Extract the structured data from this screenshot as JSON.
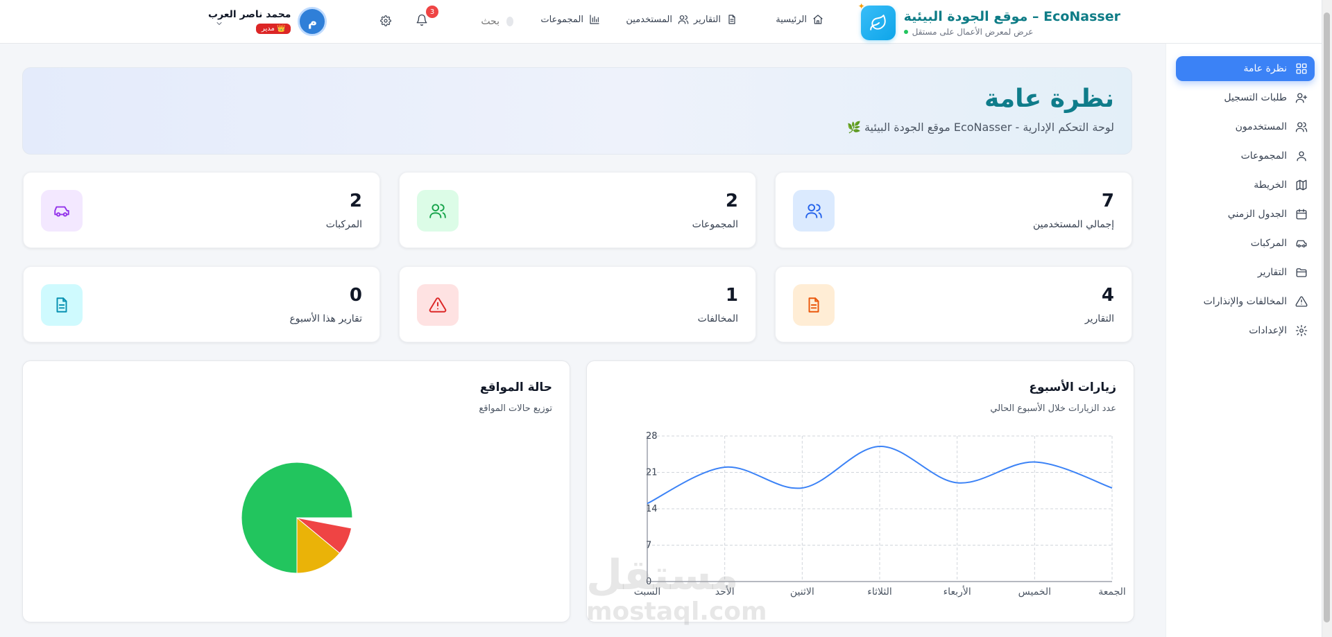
{
  "header": {
    "brand_title": "EcoNasser – موقع الجودة البيئية",
    "brand_subtitle": "عرض لمعرض الأعمال على مستقل",
    "nav": [
      {
        "label": "الرئيسية",
        "icon": "home-icon"
      },
      {
        "label": "التقارير",
        "icon": "file-icon"
      },
      {
        "label": "المستخدمين",
        "icon": "users-icon"
      },
      {
        "label": "المجموعات",
        "icon": "bar-chart-icon"
      }
    ],
    "search_placeholder": "بحث",
    "notification_count": "3",
    "user_name": "محمد ناصر العرب",
    "user_role": "👑 مدير",
    "avatar_letter": "م"
  },
  "sidebar": {
    "items": [
      {
        "label": "نظرة عامة",
        "icon": "grid-icon",
        "active": true
      },
      {
        "label": "طلبات التسجيل",
        "icon": "user-plus-icon",
        "active": false
      },
      {
        "label": "المستخدمون",
        "icon": "users-icon",
        "active": false
      },
      {
        "label": "المجموعات",
        "icon": "user-group-icon",
        "active": false
      },
      {
        "label": "الخريطة",
        "icon": "map-icon",
        "active": false
      },
      {
        "label": "الجدول الزمني",
        "icon": "calendar-icon",
        "active": false
      },
      {
        "label": "المركبات",
        "icon": "car-icon",
        "active": false
      },
      {
        "label": "التقارير",
        "icon": "folder-icon",
        "active": false
      },
      {
        "label": "المخالفات والإنذارات",
        "icon": "warning-icon",
        "active": false
      },
      {
        "label": "الإعدادات",
        "icon": "gear-icon",
        "active": false
      }
    ]
  },
  "hero": {
    "title": "نظرة عامة",
    "subtitle": "لوحة التحكم الإدارية - EcoNasser موقع الجودة البيئية",
    "leaf": "🌿"
  },
  "stats": [
    {
      "value": "7",
      "label": "إجمالي المستخدمين",
      "icon": "users-icon",
      "color": "#2563eb",
      "bg": "#dbeafe"
    },
    {
      "value": "2",
      "label": "المجموعات",
      "icon": "users-icon",
      "color": "#16a34a",
      "bg": "#dcfce7"
    },
    {
      "value": "2",
      "label": "المركبات",
      "icon": "car-icon",
      "color": "#9333ea",
      "bg": "#f3e8ff"
    },
    {
      "value": "4",
      "label": "التقارير",
      "icon": "file-icon",
      "color": "#ea580c",
      "bg": "#ffedd5"
    },
    {
      "value": "1",
      "label": "المخالفات",
      "icon": "warning-icon",
      "color": "#dc2626",
      "bg": "#fee2e2"
    },
    {
      "value": "0",
      "label": "تقارير هذا الأسبوع",
      "icon": "file-icon",
      "color": "#0891b2",
      "bg": "#cffafe"
    }
  ],
  "visits_panel": {
    "title": "زيارات الأسبوع",
    "subtitle": "عدد الزيارات خلال الأسبوع الحالي"
  },
  "sites_panel": {
    "title": "حالة المواقع",
    "subtitle": "توزيع حالات المواقع"
  },
  "watermark": {
    "text": "مستقل",
    "url": "mostaql.com"
  },
  "chart_data": [
    {
      "type": "line",
      "x": [
        "السبت",
        "الأحد",
        "الاثنين",
        "الثلاثاء",
        "الأربعاء",
        "الخميس",
        "الجمعة"
      ],
      "series": [
        {
          "values": [
            15,
            22,
            18,
            26,
            19,
            23,
            18
          ]
        }
      ],
      "ylim": [
        0,
        28
      ],
      "yticks": [
        0,
        7,
        14,
        21,
        28
      ],
      "grid": true,
      "color": "#3b82f6"
    },
    {
      "type": "pie",
      "slices": [
        {
          "value": 75,
          "color": "#22c55e"
        },
        {
          "value": 14,
          "color": "#eab308"
        },
        {
          "value": 8,
          "color": "#ef4444"
        }
      ]
    }
  ]
}
